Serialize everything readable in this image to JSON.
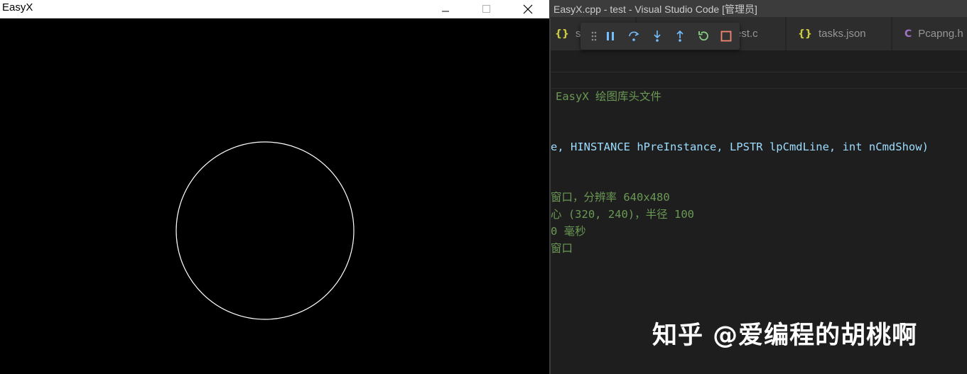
{
  "easyx_window": {
    "title": "EasyX",
    "controls": [
      "minimize",
      "maximize",
      "close"
    ],
    "canvas": {
      "background": "#000000",
      "shape": "circle",
      "stroke": "#ffffff"
    }
  },
  "vscode": {
    "title": "EasyX.cpp - test - Visual Studio Code [管理员]",
    "tabs": [
      {
        "icon": "{}",
        "label": "se",
        "icon_color": "#cbcb41"
      },
      {
        "icon": "",
        "label": "est.c",
        "icon_color": ""
      },
      {
        "icon": "{}",
        "label": "tasks.json",
        "icon_color": "#cbcb41"
      },
      {
        "icon": "C",
        "label": "Pcapng.h",
        "icon_color": "#a074c4"
      }
    ],
    "code_lines": [
      "EasyX 绘图库头文件",
      "e, HINSTANCE hPreInstance, LPSTR lpCmdLine, int nCmdShow)",
      "窗口，分辨率 640x480",
      "心 (320, 240)，半径 100",
      "0 毫秒",
      "窗口"
    ]
  },
  "debug_toolbar": {
    "buttons": [
      {
        "name": "drag-handle-icon",
        "color": "#8c8c8c"
      },
      {
        "name": "pause-icon",
        "color": "#75beff"
      },
      {
        "name": "step-over-icon",
        "color": "#75beff"
      },
      {
        "name": "step-into-icon",
        "color": "#75beff"
      },
      {
        "name": "step-out-icon",
        "color": "#75beff"
      },
      {
        "name": "restart-icon",
        "color": "#89d185"
      },
      {
        "name": "stop-icon",
        "color": "#f48771"
      }
    ]
  },
  "watermark": "知乎 @爱编程的胡桃啊"
}
